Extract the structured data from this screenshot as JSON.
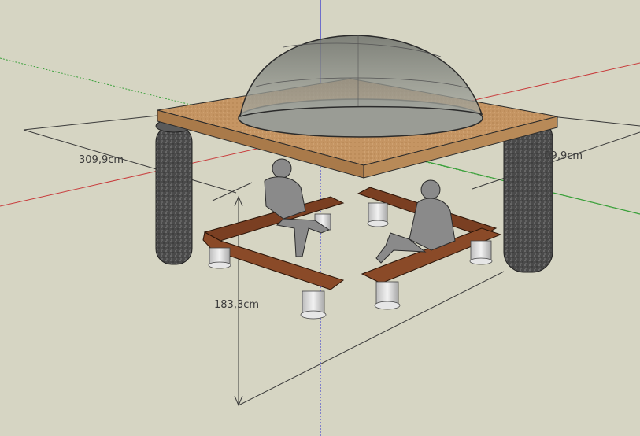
{
  "viewport": {
    "background": "#d6d5c3",
    "axis_colors": {
      "red": "#c83c3c",
      "green": "#3aa03a",
      "blue": "#2a2ad0"
    }
  },
  "model": {
    "name_icons": [
      "gazebo-model",
      "dome-skylight",
      "stone-column",
      "wooden-bench",
      "seated-figure"
    ],
    "colors": {
      "roof_top": "#c79a6a",
      "roof_edge": "#b58453",
      "dome": "#8c8f87",
      "column": "#4f4f4f",
      "bench_wood": "#7a3f22",
      "bench_leg": "#d9d9d9",
      "figure": "#8a8a8a"
    }
  },
  "dimensions": {
    "width_left": "309,9cm",
    "width_right": "309,9cm",
    "height": "183,3cm"
  }
}
